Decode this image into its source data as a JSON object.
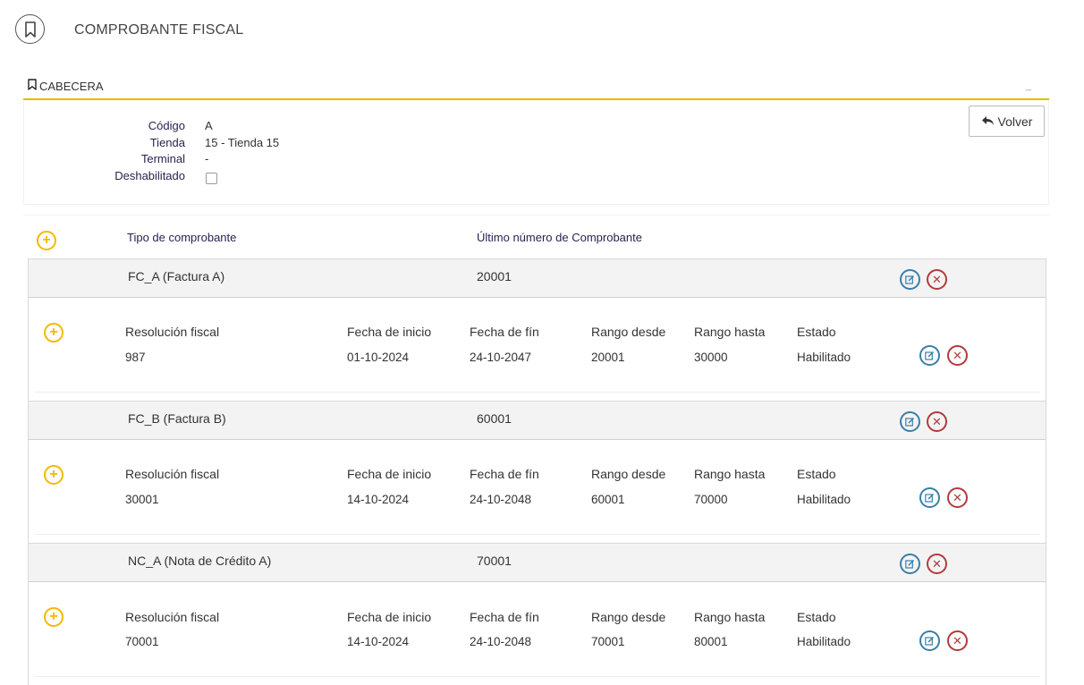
{
  "page": {
    "title": "COMPROBANTE FISCAL"
  },
  "section": {
    "title": "CABECERA",
    "collapse": "_"
  },
  "header": {
    "fields": [
      {
        "label": "Código",
        "value": "A"
      },
      {
        "label": "Tienda",
        "value": "15 - Tienda 15"
      },
      {
        "label": "Terminal",
        "value": "-"
      },
      {
        "label": "Deshabilitado",
        "value": ""
      }
    ],
    "disabled_checked": false,
    "back_label": "Volver"
  },
  "list": {
    "col_type": "Tipo de comprobante",
    "col_last_number": "Último número de Comprobante"
  },
  "detail_columns": [
    "Resolución fiscal",
    "Fecha de inicio",
    "Fecha de fín",
    "Rango desde",
    "Rango hasta",
    "Estado"
  ],
  "vouchers": [
    {
      "type": "FC_A (Factura A)",
      "last_number": "20001",
      "detail": {
        "resolution": "987",
        "start": "01-10-2024",
        "end": "24-10-2047",
        "from": "20001",
        "to": "30000",
        "status": "Habilitado"
      }
    },
    {
      "type": "FC_B (Factura B)",
      "last_number": "60001",
      "detail": {
        "resolution": "30001",
        "start": "14-10-2024",
        "end": "24-10-2048",
        "from": "60001",
        "to": "70000",
        "status": "Habilitado"
      }
    },
    {
      "type": "NC_A (Nota de Crédito A)",
      "last_number": "70001",
      "detail": {
        "resolution": "70001",
        "start": "14-10-2024",
        "end": "24-10-2048",
        "from": "70001",
        "to": "80001",
        "status": "Habilitado"
      }
    }
  ],
  "icons": {
    "bookmark": "bookmark-icon",
    "add": "plus-circle-icon",
    "edit": "edit-icon",
    "delete": "close-circle-icon",
    "back": "reply-arrow-icon"
  },
  "colors": {
    "accent": "#f0b400",
    "edit": "#3a7fa8",
    "delete": "#b23b3b",
    "label": "#2a1f4c"
  }
}
